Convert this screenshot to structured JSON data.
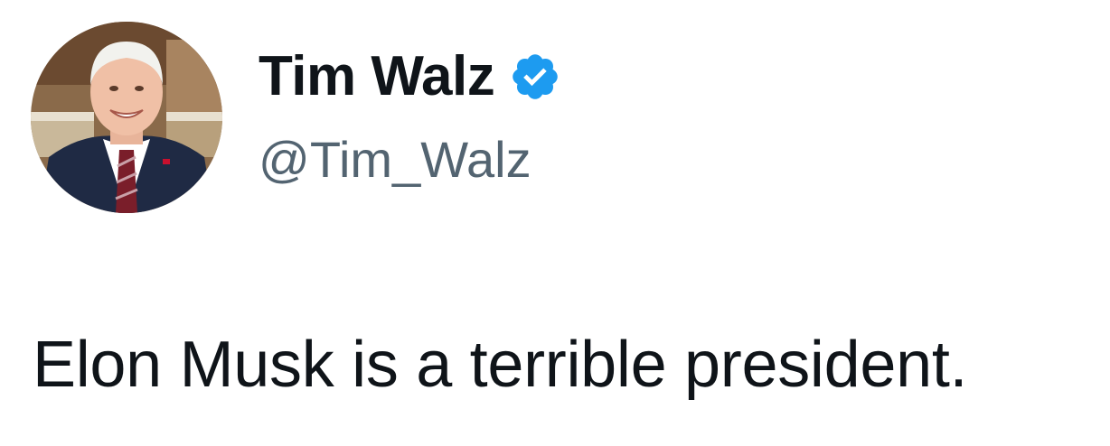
{
  "tweet": {
    "author": {
      "display_name": "Tim Walz",
      "handle": "@Tim_Walz",
      "verified": true,
      "avatar_icon": "profile-photo"
    },
    "text": "Elon Musk is a terrible president."
  },
  "colors": {
    "verified_badge": "#1d9bf0",
    "name_text": "#0f1419",
    "handle_text": "#536471",
    "body_text": "#0f1419"
  }
}
